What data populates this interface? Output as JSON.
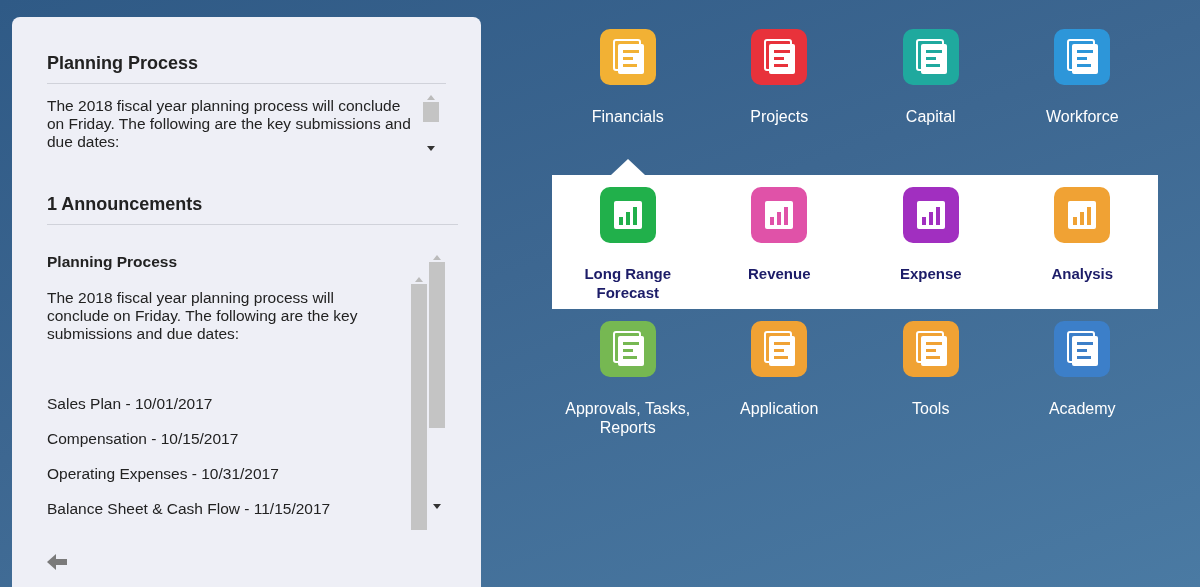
{
  "info": {
    "title": "Planning Process",
    "body": "The 2018 fiscal year planning process will conclude on Friday. The following are the key submissions and due dates:"
  },
  "announcements": {
    "heading": "1 Announcements",
    "title": "Planning Process",
    "body": "The 2018 fiscal year planning process will conclude on Friday. The following are the key submissions and due dates:",
    "items": [
      "Sales Plan - 10/01/2017",
      "Compensation - 10/15/2017",
      "Operating Expenses - 10/31/2017",
      "Balance Sheet & Cash Flow - 11/15/2017"
    ]
  },
  "tiles": [
    {
      "label": "Financials",
      "color": "#f2b134",
      "selected": true
    },
    {
      "label": "Projects",
      "color": "#e8323b",
      "selected": false
    },
    {
      "label": "Capital",
      "color": "#1fa99e",
      "selected": false
    },
    {
      "label": "Workforce",
      "color": "#2d96d9",
      "selected": false
    },
    {
      "label": "Approvals, Tasks, Reports",
      "color": "#76b852",
      "selected": false
    },
    {
      "label": "Application",
      "color": "#f0a234",
      "selected": false
    },
    {
      "label": "Tools",
      "color": "#f0a234",
      "selected": false
    },
    {
      "label": "Academy",
      "color": "#3c7fc9",
      "selected": false
    }
  ],
  "flyout": [
    {
      "label": "Long Range Forecast",
      "color": "#21b04b"
    },
    {
      "label": "Revenue",
      "color": "#e052a8"
    },
    {
      "label": "Expense",
      "color": "#a12fc0"
    },
    {
      "label": "Analysis",
      "color": "#f0a234"
    }
  ]
}
